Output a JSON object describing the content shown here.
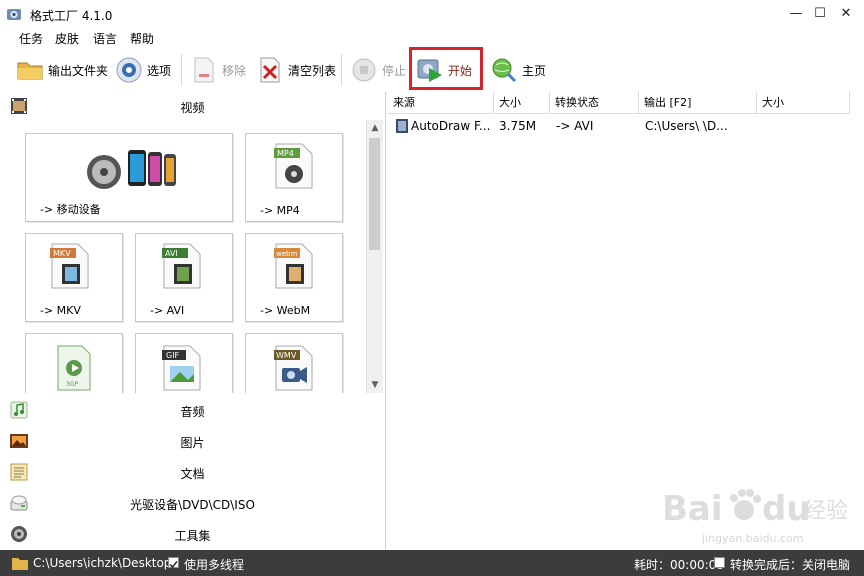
{
  "window": {
    "title": "格式工厂 4.1.0",
    "controls": [
      "—",
      "☐",
      "✕"
    ]
  },
  "menu": [
    "任务",
    "皮肤",
    "语言",
    "帮助"
  ],
  "toolbar": {
    "output_folder": "输出文件夹",
    "options": "选项",
    "remove": "移除",
    "clear_list": "清空列表",
    "stop": "停止",
    "start": "开始",
    "home": "主页"
  },
  "left_panel": {
    "video_label": "视频",
    "tiles": [
      {
        "label": "-> 移动设备"
      },
      {
        "label": "-> MP4",
        "badge": "MP4",
        "badge_color": "#5f9d3a"
      },
      {
        "label": "-> MKV",
        "badge": "MKV",
        "badge_color": "#d0793a"
      },
      {
        "label": "-> AVI",
        "badge": "AVI",
        "badge_color": "#3d7d2f"
      },
      {
        "label": "-> WebM",
        "badge": "webm",
        "badge_color": "#d88a3a"
      },
      {
        "label": "",
        "badge": "3GP",
        "badge_color": "#5a9a4a"
      },
      {
        "label": "",
        "badge": "GIF",
        "badge_color": "#333333"
      },
      {
        "label": "",
        "badge": "WMV",
        "badge_color": "#6a5a2a"
      }
    ],
    "categories": [
      "音频",
      "图片",
      "文档",
      "光驱设备\\DVD\\CD\\ISO",
      "工具集"
    ]
  },
  "task_list": {
    "columns": [
      "来源",
      "大小",
      "转换状态",
      "输出 [F2]",
      "大小"
    ],
    "rows": [
      {
        "source": "AutoDraw F...",
        "size": "3.75M",
        "status": "-> AVI",
        "output": "C:\\Users\\    \\D...",
        "out_size": ""
      }
    ]
  },
  "statusbar": {
    "path": "C:\\Users\\ichzk\\Desktop",
    "multithread_label": "使用多线程",
    "multithread_checked": true,
    "elapsed": "耗时：00:00:00",
    "shutdown_label": "转换完成后：关闭电脑",
    "shutdown_checked": false
  },
  "watermark": {
    "brand": "Bai",
    "brand2": "du",
    "cn": "经验",
    "url": "jingyan.baidu.com"
  },
  "colors": {
    "highlight": "#d8232a",
    "statusbar": "#3c3c3c"
  }
}
